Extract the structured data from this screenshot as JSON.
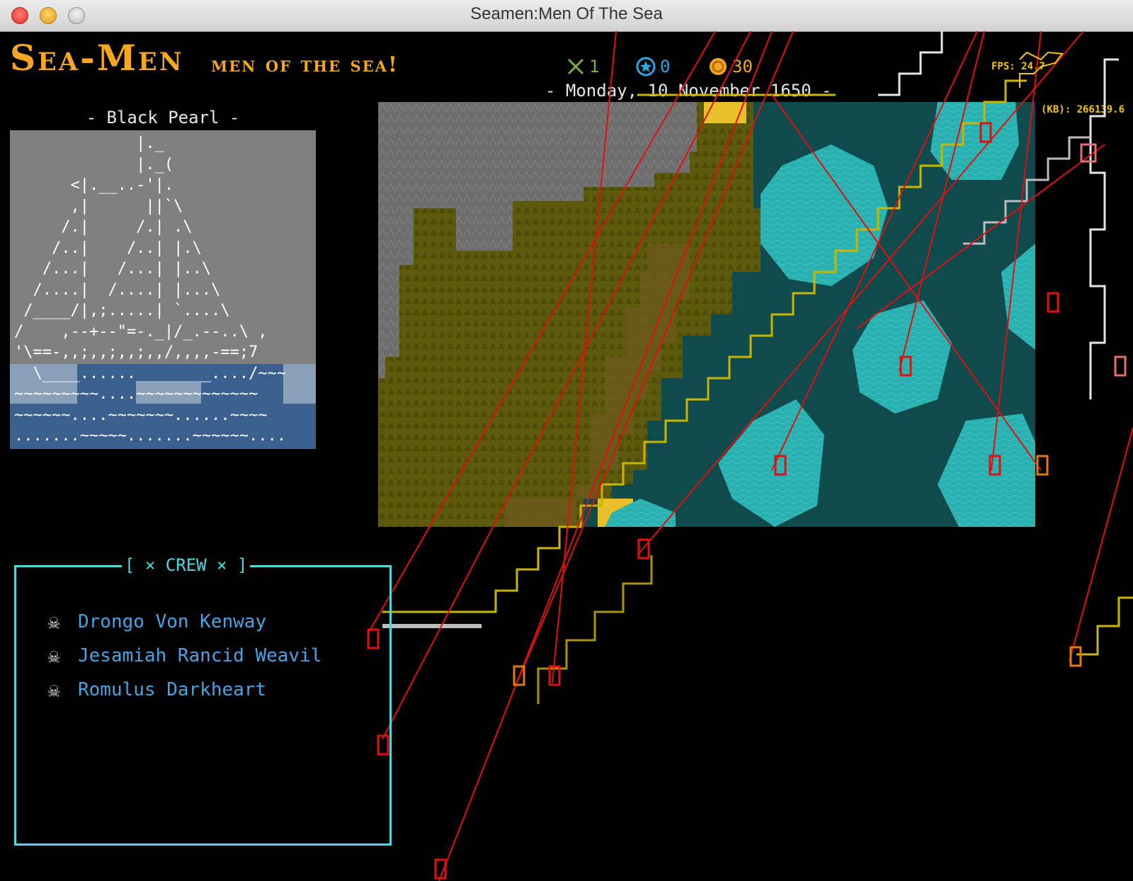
{
  "window": {
    "title": "Seamen:Men Of The Sea"
  },
  "header": {
    "title": "Sea-Men",
    "subtitle": "men of the sea!"
  },
  "stats": {
    "swords": {
      "icon": "crossed-swords-icon",
      "value": "1",
      "color": "#7bb03a"
    },
    "stars": {
      "icon": "star-circle-icon",
      "value": "0",
      "color": "#29a8e0"
    },
    "gold": {
      "icon": "gold-coin-icon",
      "value": "30",
      "color": "#f5a623"
    }
  },
  "date": {
    "text": "- Monday, 10 November 1650 -"
  },
  "debug": {
    "fps": "FPS: 24.7",
    "memory": "(KB): 266139.6"
  },
  "ship": {
    "name": "- Black Pearl -",
    "ascii": "             |._\n             |._(\n      <|.__..-'|.\n      ,|      ||`\\\n     /.|     /.| .\\\n    /..|    /..| |.\\\n   /...|   /...| |..\\\n  /....|  /....| |...\\\n /____/|,;.....| `....\\\n/    ,--+--\"=-._|/_.--..\\ ,\n'\\==-,,;,,;,,;,,/,,,,-==;7\n  \\____......________..../~~~\n~~~~~~~~~....~~~~~~~~~~~~~\n~~~~~~....~~~~~~~......~~~~\n.......~~~~~.......~~~~~~...."
  },
  "map": {
    "colors": {
      "mountain": "#6e6e6e",
      "land": "#5e5a0c",
      "sand": "#6b5a1c",
      "deep_water": "#0f4a4c",
      "shallow_water": "#2bb0b0",
      "beach": "#e8c12a"
    }
  },
  "crew": {
    "title": "[ × CREW × ]",
    "members": [
      {
        "name": "Drongo Von Kenway",
        "icon": "skull-crossbones-icon"
      },
      {
        "name": "Jesamiah Rancid Weavil",
        "icon": "skull-crossbones-icon"
      },
      {
        "name": "Romulus Darkheart",
        "icon": "skull-crossbones-icon"
      }
    ]
  }
}
